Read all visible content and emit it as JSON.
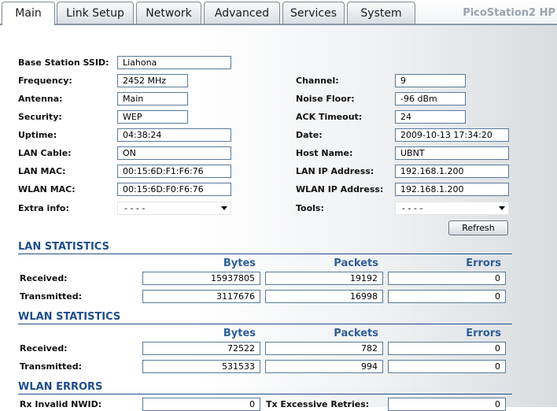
{
  "tabs": [
    {
      "label": "Main",
      "active": true
    },
    {
      "label": "Link Setup",
      "active": false
    },
    {
      "label": "Network",
      "active": false
    },
    {
      "label": "Advanced",
      "active": false
    },
    {
      "label": "Services",
      "active": false
    },
    {
      "label": "System",
      "active": false
    }
  ],
  "brand": "PicoStation2 HP",
  "fields": {
    "ssid": {
      "label": "Base Station SSID:",
      "value": "Liahona"
    },
    "frequency": {
      "label": "Frequency:",
      "value": "2452 MHz"
    },
    "antenna": {
      "label": "Antenna:",
      "value": "Main"
    },
    "security": {
      "label": "Security:",
      "value": "WEP"
    },
    "uptime": {
      "label": "Uptime:",
      "value": "04:38:24"
    },
    "lan_cable": {
      "label": "LAN Cable:",
      "value": "ON"
    },
    "lan_mac": {
      "label": "LAN MAC:",
      "value": "00:15:6D:F1:F6:76"
    },
    "wlan_mac": {
      "label": "WLAN MAC:",
      "value": "00:15:6D:F0:F6:76"
    },
    "extra_info": {
      "label": "Extra info:",
      "value": "- - - -"
    },
    "channel": {
      "label": "Channel:",
      "value": "9"
    },
    "noise_floor": {
      "label": "Noise Floor:",
      "value": "-96 dBm"
    },
    "ack_timeout": {
      "label": "ACK Timeout:",
      "value": "24"
    },
    "date": {
      "label": "Date:",
      "value": "2009-10-13 17:34:20"
    },
    "host_name": {
      "label": "Host Name:",
      "value": "UBNT"
    },
    "lan_ip": {
      "label": "LAN IP Address:",
      "value": "192.168.1.200"
    },
    "wlan_ip": {
      "label": "WLAN IP Address:",
      "value": "192.168.1.200"
    },
    "tools": {
      "label": "Tools:",
      "value": "- - - -"
    }
  },
  "refresh_label": "Refresh",
  "columns": {
    "bytes": "Bytes",
    "packets": "Packets",
    "errors": "Errors"
  },
  "lan_stats": {
    "title": "LAN STATISTICS",
    "received": {
      "label": "Received:",
      "bytes": "15937805",
      "packets": "19192",
      "errors": "0"
    },
    "transmitted": {
      "label": "Transmitted:",
      "bytes": "3117676",
      "packets": "16998",
      "errors": "0"
    }
  },
  "wlan_stats": {
    "title": "WLAN STATISTICS",
    "received": {
      "label": "Received:",
      "bytes": "72522",
      "packets": "782",
      "errors": "0"
    },
    "transmitted": {
      "label": "Transmitted:",
      "bytes": "531533",
      "packets": "994",
      "errors": "0"
    }
  },
  "wlan_errors": {
    "title": "WLAN ERRORS",
    "rx_invalid_nwid": {
      "label": "Rx Invalid NWID:",
      "value": "0"
    },
    "tx_excessive_retries": {
      "label": "Tx Excessive Retries:",
      "value": "0"
    }
  }
}
